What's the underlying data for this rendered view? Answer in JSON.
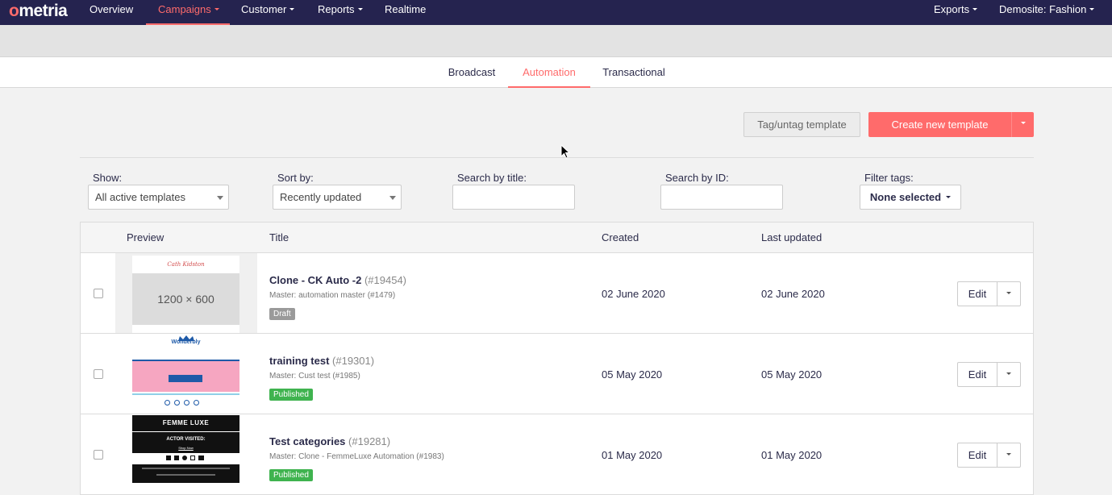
{
  "app": {
    "logo_text": "metria",
    "logo_first": "o"
  },
  "topnav": {
    "items": [
      {
        "label": "Overview",
        "caret": false,
        "active": false
      },
      {
        "label": "Campaigns",
        "caret": true,
        "active": true
      },
      {
        "label": "Customer",
        "caret": true,
        "active": false
      },
      {
        "label": "Reports",
        "caret": true,
        "active": false
      },
      {
        "label": "Realtime",
        "caret": false,
        "active": false
      }
    ],
    "right": [
      {
        "label": "Exports",
        "caret": true
      },
      {
        "label": "Demosite: Fashion",
        "caret": true
      }
    ]
  },
  "subnav": {
    "tabs": [
      {
        "label": "Broadcast",
        "active": false
      },
      {
        "label": "Automation",
        "active": true
      },
      {
        "label": "Transactional",
        "active": false
      }
    ]
  },
  "actions": {
    "tag_label": "Tag/untag template",
    "create_label": "Create new template"
  },
  "filters": {
    "show_label": "Show:",
    "show_value": "All active templates",
    "sort_label": "Sort by:",
    "sort_value": "Recently updated",
    "search_title_label": "Search by title:",
    "search_title_value": "",
    "search_id_label": "Search by ID:",
    "search_id_value": "",
    "filter_tags_label": "Filter tags:",
    "filter_tags_value": "None selected"
  },
  "table": {
    "headers": {
      "preview": "Preview",
      "title": "Title",
      "created": "Created",
      "updated": "Last updated"
    },
    "rows": [
      {
        "title": "Clone - CK Auto -2",
        "id": "(#19454)",
        "master": "Master: automation master (#1479)",
        "status": "Draft",
        "created": "02 June 2020",
        "updated": "02 June 2020",
        "edit": "Edit",
        "preview": {
          "kind": "placeholder",
          "brand": "Cath Kidston",
          "placeholder": "1200 × 600"
        }
      },
      {
        "title": "training test",
        "id": "(#19301)",
        "master": "Master: Cust test (#1985)",
        "status": "Published",
        "created": "05 May 2020",
        "updated": "05 May 2020",
        "edit": "Edit",
        "preview": {
          "kind": "wonderbly",
          "brand": "Wonderbly"
        }
      },
      {
        "title": "Test categories",
        "id": "(#19281)",
        "master": "Master: Clone - FemmeLuxe Automation (#1983)",
        "status": "Published",
        "created": "01 May 2020",
        "updated": "01 May 2020",
        "edit": "Edit",
        "preview": {
          "kind": "femmeluxe",
          "brand": "FEMME LUXE",
          "headline": "ACTOR VISITED:",
          "cta": "Shop Now"
        }
      }
    ]
  },
  "colors": {
    "nav_bg": "#25234f",
    "accent": "#ff6b6b",
    "published": "#3fb34f",
    "draft": "#9a9a9a"
  }
}
